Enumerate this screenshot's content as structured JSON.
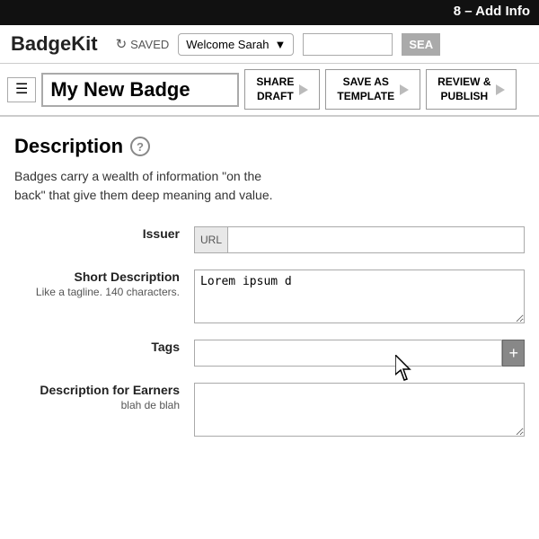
{
  "top_bar": {
    "text": "8 – Add Info"
  },
  "header": {
    "app_title": "BadgeKit",
    "saved_label": "SAVED",
    "user_label": "Welcome Sarah",
    "search_placeholder": "",
    "search_btn_label": "SEA"
  },
  "toolbar": {
    "menu_icon": "☰",
    "badge_title": "My New Badge",
    "share_draft_label": "SHARE\nDRAFT",
    "save_as_template_label": "SAVE AS\nTEMPLATE",
    "review_publish_label": "REVIEW &\nPUBLISH"
  },
  "main": {
    "section_title": "Description",
    "help_icon_label": "?",
    "description_text": "Badges carry a wealth of information \"on the back\" that give them deep meaning and value.",
    "form_rows": [
      {
        "label": "Issuer",
        "sublabel": "",
        "input_type": "url",
        "url_prefix": "URL",
        "placeholder": "",
        "value": ""
      },
      {
        "label": "Short Description",
        "sublabel": "Like a tagline. 140 characters.",
        "input_type": "textarea",
        "placeholder": "Lorem ipsum d",
        "value": "Lorem ipsum d"
      },
      {
        "label": "Tags",
        "sublabel": "",
        "input_type": "tags",
        "placeholder": "",
        "value": ""
      },
      {
        "label": "Description for Earners",
        "sublabel": "blah de blah",
        "input_type": "textarea",
        "placeholder": "",
        "value": ""
      }
    ]
  }
}
